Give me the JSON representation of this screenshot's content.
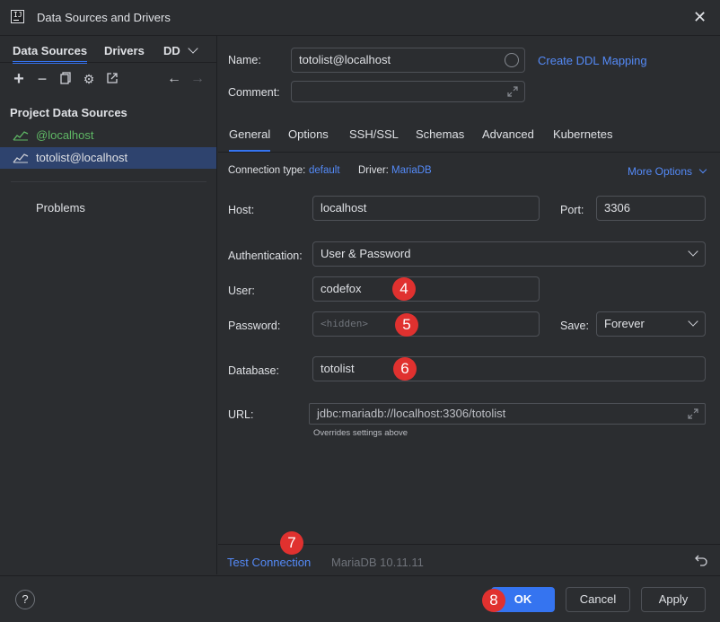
{
  "window": {
    "title": "Data Sources and Drivers"
  },
  "left": {
    "tabs": [
      "Data Sources",
      "Drivers",
      "DD"
    ],
    "section_title": "Project Data Sources",
    "items": [
      {
        "label": "@localhost",
        "color": "#5fb865"
      },
      {
        "label": "totolist@localhost",
        "color": "#dfe1e5"
      }
    ],
    "problems": "Problems"
  },
  "form": {
    "name_label": "Name:",
    "name_value": "totolist@localhost",
    "ddl_link": "Create DDL Mapping",
    "comment_label": "Comment:",
    "comment_value": ""
  },
  "tabs": [
    "General",
    "Options",
    "SSH/SSL",
    "Schemas",
    "Advanced",
    "Kubernetes"
  ],
  "general": {
    "conn_type_label": "Connection type:",
    "conn_type_value": "default",
    "driver_label": "Driver:",
    "driver_value": "MariaDB",
    "more_options": "More Options",
    "host_label": "Host:",
    "host_value": "localhost",
    "port_label": "Port:",
    "port_value": "3306",
    "auth_label": "Authentication:",
    "auth_value": "User & Password",
    "user_label": "User:",
    "user_value": "codefox",
    "password_label": "Password:",
    "password_placeholder": "<hidden>",
    "save_label": "Save:",
    "save_value": "Forever",
    "database_label": "Database:",
    "database_value": "totolist",
    "url_label": "URL:",
    "url_value": "jdbc:mariadb://localhost:3306/totolist",
    "url_hint": "Overrides settings above"
  },
  "status": {
    "test_connection": "Test Connection",
    "version": "MariaDB 10.11.11"
  },
  "buttons": {
    "ok": "OK",
    "cancel": "Cancel",
    "apply": "Apply",
    "help": "?"
  },
  "badges": [
    "4",
    "5",
    "6",
    "7",
    "8"
  ],
  "colors": {
    "accent": "#3574f0",
    "link": "#548af7",
    "badge": "#e0312f",
    "selection": "#2e436e"
  }
}
